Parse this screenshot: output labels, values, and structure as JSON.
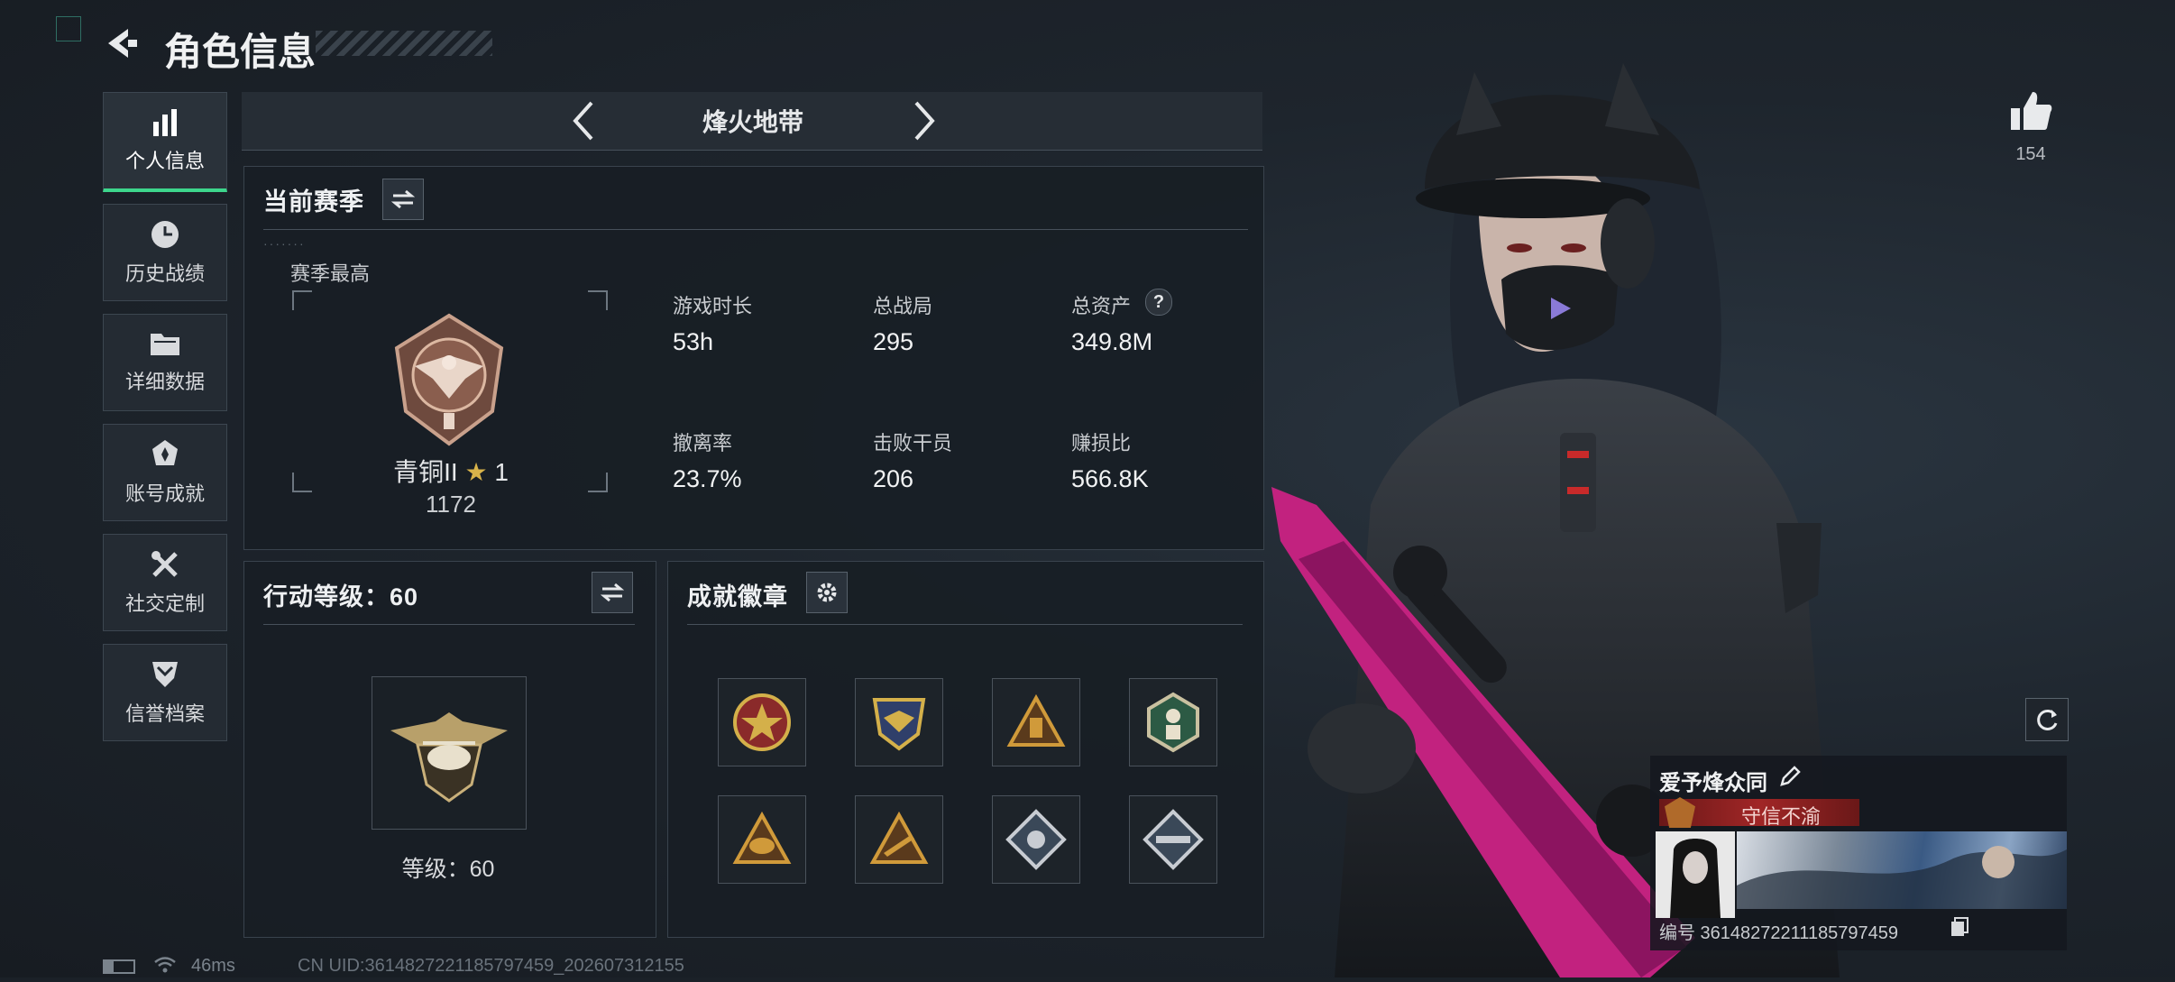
{
  "header": {
    "title": "角色信息"
  },
  "sidebar": {
    "items": [
      {
        "label": "个人信息",
        "icon": "bar-chart-icon",
        "active": true
      },
      {
        "label": "历史战绩",
        "icon": "history-clock-icon"
      },
      {
        "label": "详细数据",
        "icon": "folder-icon"
      },
      {
        "label": "账号成就",
        "icon": "achievement-icon"
      },
      {
        "label": "社交定制",
        "icon": "tools-icon"
      },
      {
        "label": "信誉档案",
        "icon": "shield-chevron-icon"
      }
    ]
  },
  "mode_selector": {
    "label": "烽火地带"
  },
  "season": {
    "title": "当前赛季",
    "best_label": "赛季最高",
    "rank_name": "青铜II",
    "rank_stars": "1",
    "rank_score": "1172",
    "stats": [
      {
        "label": "游戏时长",
        "value": "53h"
      },
      {
        "label": "总战局",
        "value": "295"
      },
      {
        "label": "总资产",
        "value": "349.8M",
        "help": "?"
      },
      {
        "label": "撤离率",
        "value": "23.7%"
      },
      {
        "label": "击败干员",
        "value": "206"
      },
      {
        "label": "赚损比",
        "value": "566.8K"
      }
    ]
  },
  "action_level": {
    "title": "行动等级：60",
    "level_text": "等级：60"
  },
  "achievements": {
    "title": "成就徽章"
  },
  "likes": {
    "count": "154"
  },
  "profile_card": {
    "name": "爱予烽众同",
    "reputation": "守信不渝",
    "id_text": "编号 3614827221118579745​9"
  },
  "status_bar": {
    "ping": "46ms",
    "uid": "CN UID:3614827221185797459_202607312155"
  },
  "colors": {
    "accent_green": "#3dd68c",
    "reputation_red": "#8a1f1f",
    "pink": "#d01e8a"
  }
}
